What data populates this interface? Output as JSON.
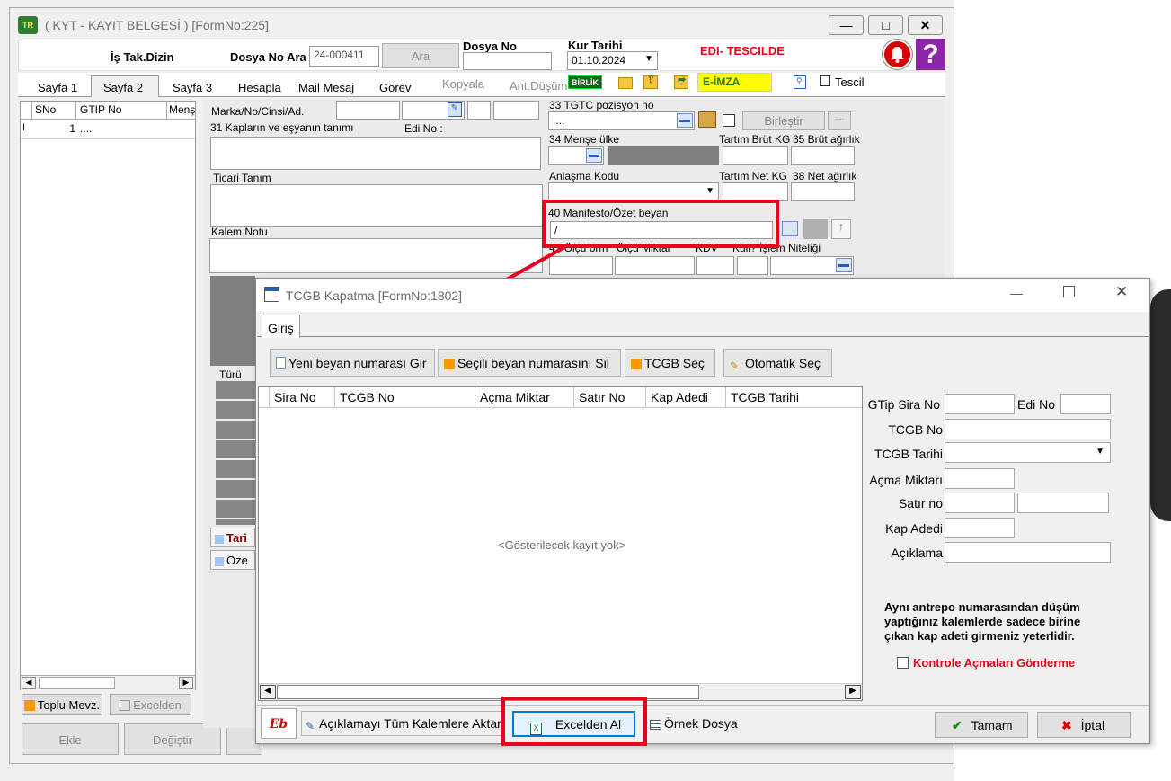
{
  "main_window": {
    "title": "( KYT - KAYIT BELGESİ ) [FormNo:225]",
    "is_tak_dizin": "İş Tak.Dizin",
    "dosya_no_ara_label": "Dosya No Ara",
    "dosya_no_ara_value": "24-000411",
    "ara_button": "Ara",
    "dosya_no_label": "Dosya No",
    "kur_tarihi_label": "Kur Tarihi",
    "kur_tarihi_value": "01.10.2024",
    "status_text": "EDI- TESCILDE",
    "tabs": [
      "Sayfa 1",
      "Sayfa 2",
      "Sayfa 3",
      "Hesapla",
      "Mail Mesaj",
      "Görev",
      "Kopyala",
      "Ant.Düşüm"
    ],
    "birlik_badge": "BİRLİK",
    "e_imza": "E-İMZA",
    "tescil_label": "Tescil",
    "grid_headers": [
      "SNo",
      "GTIP No",
      "Menş"
    ],
    "grid_row": {
      "sno": "1",
      "gtip": "...."
    },
    "toplu_mevz": "Toplu Mevz.",
    "excelden_small": "Excelden",
    "bottom_buttons": [
      "Ekle",
      "Değiştir"
    ],
    "accent_color": "#e8001c"
  },
  "item_form": {
    "marka_label": "Marka/No/Cinsi/Ad.",
    "kaplar_label": "31 Kapların ve eşyanın tanımı",
    "edi_no_label": "Edi No :",
    "ticari_tanim_label": "Ticari Tanım",
    "kalem_notu_label": "Kalem Notu",
    "turu_label": "Türü",
    "tari_label": "Tari",
    "oze_label": "Öze",
    "tgtc_label": "33 TGTC pozisyon no",
    "tgtc_value": "....",
    "birlestir_button": "Birleştir",
    "mense_label": "34 Menşe ülke",
    "tartim_brut_label": "Tartım Brüt KG",
    "brut_agirlik_label": "35 Brüt ağırlık",
    "anlasma_label": "Anlaşma Kodu",
    "tartim_net_label": "Tartım Net KG",
    "net_agirlik_label": "38 Net ağırlık",
    "manifesto_label": "40 Manifesto/Özet beyan",
    "manifesto_value": "/",
    "olcu_label": "41 Ölçü brm",
    "olcu_miktar_label": "Ölçü Miktar",
    "kdv_label": "KDV",
    "kull_label": "Kull?",
    "islem_label": "İşlem Niteliği"
  },
  "dialog": {
    "title": "TCGB Kapatma [FormNo:1802]",
    "tab_giris": "Giriş",
    "toolbar": {
      "yeni": "Yeni beyan numarası Gir",
      "sil": "Seçili beyan numarasını Sil",
      "tcgb_sec": "TCGB Seç",
      "otomatik": "Otomatik Seç"
    },
    "columns": [
      "Sira No",
      "TCGB No",
      "Açma Miktar",
      "Satır No",
      "Kap Adedi",
      "TCGB Tarihi"
    ],
    "empty_text": "<Gösterilecek kayıt yok>",
    "right_panel": {
      "gtip_sira_no": "GTip Sira No",
      "edi_no": "Edi No",
      "tcgb_no": "TCGB No",
      "tcgb_tarihi": "TCGB Tarihi",
      "acma_miktari": "Açma Miktarı",
      "satir_no": "Satır no",
      "kap_adedi": "Kap Adedi",
      "aciklama": "Açıklama",
      "note": "Aynı antrepo numarasından düşüm yaptığınız kalemlerde sadece birine çıkan kap adeti girmeniz yeterlidir.",
      "kontrole_label": "Kontrole Açmaları Gönderme",
      "kontrole_checked": false
    },
    "bottom": {
      "aciklama_button": "Açıklamayı Tüm Kalemlere Aktar",
      "excelden_al": "Excelden Al",
      "ornek_dosya": "Örnek Dosya",
      "tamam": "Tamam",
      "iptal": "İptal"
    }
  }
}
